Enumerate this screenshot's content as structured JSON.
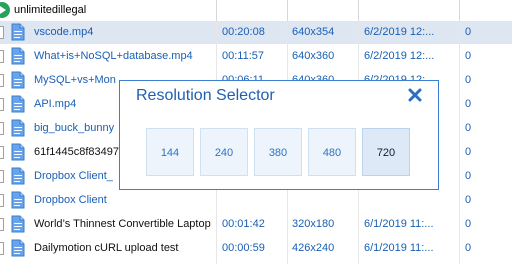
{
  "header": {
    "title": "unlimitedillegal"
  },
  "rows": [
    {
      "name": "vscode.mp4",
      "duration": "00:20:08",
      "resolution": "640x354",
      "date": "6/2/2019 12:...",
      "count": "0",
      "selected": true
    },
    {
      "name": "What+is+NoSQL+database.mp4",
      "duration": "00:11:57",
      "resolution": "640x360",
      "date": "6/2/2019 12:...",
      "count": "0"
    },
    {
      "name": "MySQL+vs+Mon",
      "duration": "00:06:11",
      "resolution": "640x360",
      "date": "6/2/2019 12:...",
      "count": "0"
    },
    {
      "name": "API.mp4",
      "duration": "",
      "resolution": "",
      "date": "",
      "count": "0"
    },
    {
      "name": "big_buck_bunny",
      "duration": "",
      "resolution": "",
      "date": "",
      "count": "0"
    },
    {
      "name": "61f1445c8f83497",
      "duration": "",
      "resolution": "",
      "date": "",
      "count": "0"
    },
    {
      "name": "Dropbox Client_",
      "duration": "",
      "resolution": "",
      "date": "",
      "count": "0"
    },
    {
      "name": "Dropbox Client",
      "duration": "",
      "resolution": "",
      "date": "",
      "count": "0"
    },
    {
      "name": "World’s Thinnest Convertible Laptop",
      "duration": "00:01:42",
      "resolution": "320x180",
      "date": "6/1/2019 11:...",
      "count": "0"
    },
    {
      "name": "Dailymotion cURL upload test",
      "duration": "00:00:59",
      "resolution": "426x240",
      "date": "6/1/2019 11:...",
      "count": "0"
    }
  ],
  "dialog": {
    "title": "Resolution Selector",
    "options": [
      "144",
      "240",
      "380",
      "480",
      "720"
    ],
    "selected": "720"
  },
  "colors": {
    "accent": "#1f5fb0",
    "link": "#1a5fb4",
    "selection": "#dde6f1",
    "play": "#25a35a"
  }
}
